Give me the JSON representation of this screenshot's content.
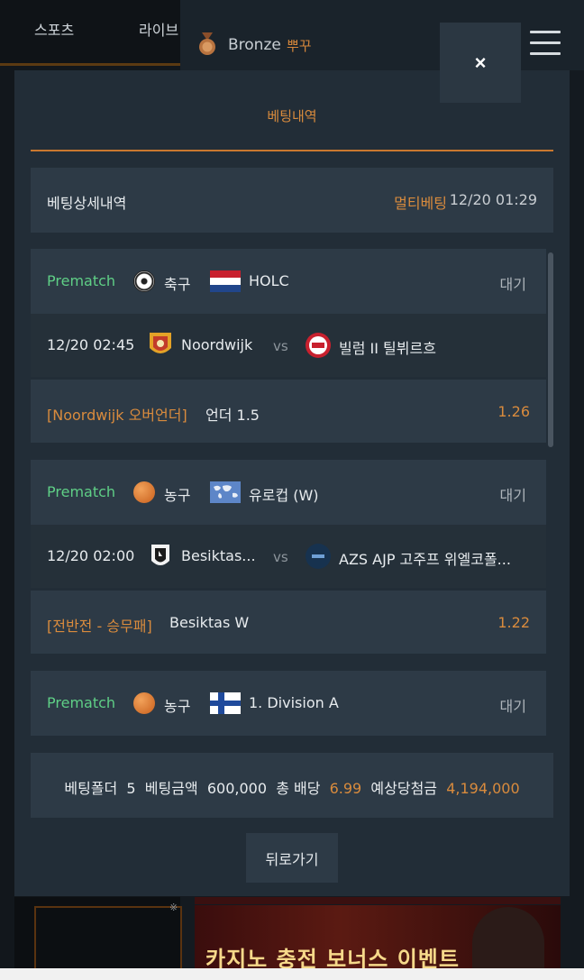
{
  "background": {
    "nav_tabs": [
      "스포츠",
      "라이브"
    ],
    "member": {
      "level": "Bronze",
      "username": "뿌꾸"
    },
    "mark": "※",
    "banner_text": "카지노 충전 보너스 이벤트"
  },
  "modal": {
    "title": "베팅내역",
    "close_label": "×",
    "detail": {
      "label": "베팅상세내역",
      "bet_type": "멀티베팅",
      "time": "12/20 01:29"
    },
    "bets": [
      {
        "category": "Prematch",
        "sport": "축구",
        "sport_icon": "soccer-ball-icon",
        "flag": "netherlands-flag-icon",
        "league": "HOLC",
        "status": "대기",
        "match_time": "12/20 02:45",
        "home": "Noordwijk",
        "vs": "vs",
        "away": "빌럼 II 틸뷔르흐",
        "market": "[Noordwijk 오버언더]",
        "choice": "언더 1.5",
        "odds": "1.26"
      },
      {
        "category": "Prematch",
        "sport": "농구",
        "sport_icon": "basketball-icon",
        "flag": "world-flag-icon",
        "league": "유로컵 (W)",
        "status": "대기",
        "match_time": "12/20 02:00",
        "home": "Besiktas...",
        "vs": "vs",
        "away": "AZS AJP 고주프 위엘코폴...",
        "market": "[전반전 - 승무패]",
        "choice": "Besiktas W",
        "odds": "1.22"
      },
      {
        "category": "Prematch",
        "sport": "농구",
        "sport_icon": "basketball-icon",
        "flag": "finland-flag-icon",
        "league": "1. Division A",
        "status": "대기"
      }
    ],
    "summary": {
      "folder_label": "베팅폴더",
      "folder_count": "5",
      "amount_label": "베팅금액",
      "amount": "600,000",
      "odds_label": "총 배당",
      "total_odds": "6.99",
      "payout_label": "예상당첨금",
      "payout": "4,194,000"
    },
    "back_label": "뒤로가기"
  },
  "colors": {
    "accent": "#d98b3d",
    "prematch": "#5fcf86",
    "panel": "#2d3a46",
    "modal_bg": "#222d37"
  }
}
